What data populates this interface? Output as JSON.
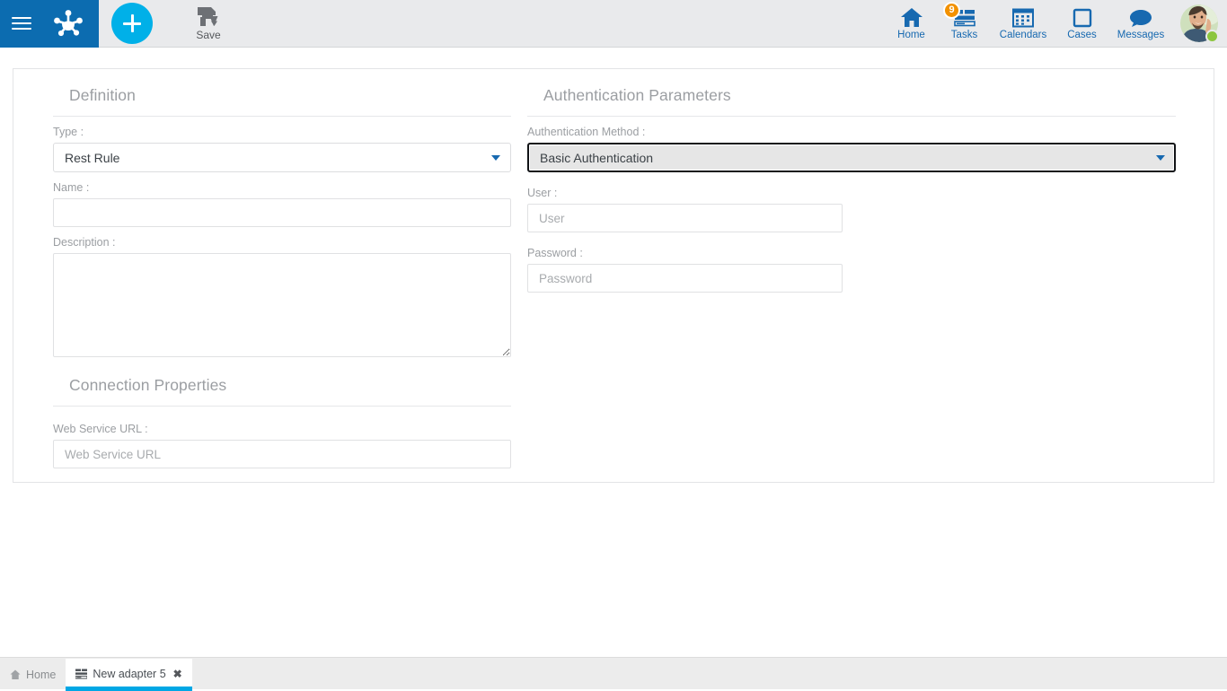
{
  "topbar": {
    "menu_icon": "hamburger-icon",
    "logo_icon": "app-logo-icon",
    "add_icon": "plus-icon",
    "save": {
      "label": "Save",
      "icon": "save-floppy-icon"
    },
    "nav": [
      {
        "label": "Home",
        "icon": "home-icon",
        "badge": null
      },
      {
        "label": "Tasks",
        "icon": "tasks-icon",
        "badge": "9"
      },
      {
        "label": "Calendars",
        "icon": "calendar-icon",
        "badge": null
      },
      {
        "label": "Cases",
        "icon": "cases-icon",
        "badge": null
      },
      {
        "label": "Messages",
        "icon": "message-icon",
        "badge": null
      }
    ],
    "avatar": {
      "icon": "user-avatar",
      "status": "online"
    }
  },
  "definition": {
    "title": "Definition",
    "type": {
      "label": "Type :",
      "value": "Rest Rule"
    },
    "name": {
      "label": "Name :",
      "value": "",
      "placeholder": ""
    },
    "description": {
      "label": "Description :",
      "value": "",
      "placeholder": ""
    }
  },
  "connection": {
    "title": "Connection Properties",
    "url": {
      "label": "Web Service URL :",
      "value": "",
      "placeholder": "Web Service URL"
    }
  },
  "auth": {
    "title": "Authentication Parameters",
    "method": {
      "label": "Authentication Method :",
      "value": "Basic Authentication"
    },
    "user": {
      "label": "User :",
      "value": "",
      "placeholder": "User"
    },
    "password": {
      "label": "Password :",
      "value": "",
      "placeholder": "Password"
    }
  },
  "tabs": [
    {
      "label": "Home",
      "icon": "home-small-icon",
      "active": false,
      "closable": false
    },
    {
      "label": "New adapter 5",
      "icon": "adapter-icon",
      "active": true,
      "closable": true,
      "close_icon": "close-x-icon"
    }
  ],
  "colors": {
    "brand_blue": "#0c6cb0",
    "accent_cyan": "#00b0e8",
    "badge_orange": "#f29100",
    "link_blue": "#1769b0",
    "online_green": "#8cc63f",
    "tab_underline": "#00a7e5"
  }
}
